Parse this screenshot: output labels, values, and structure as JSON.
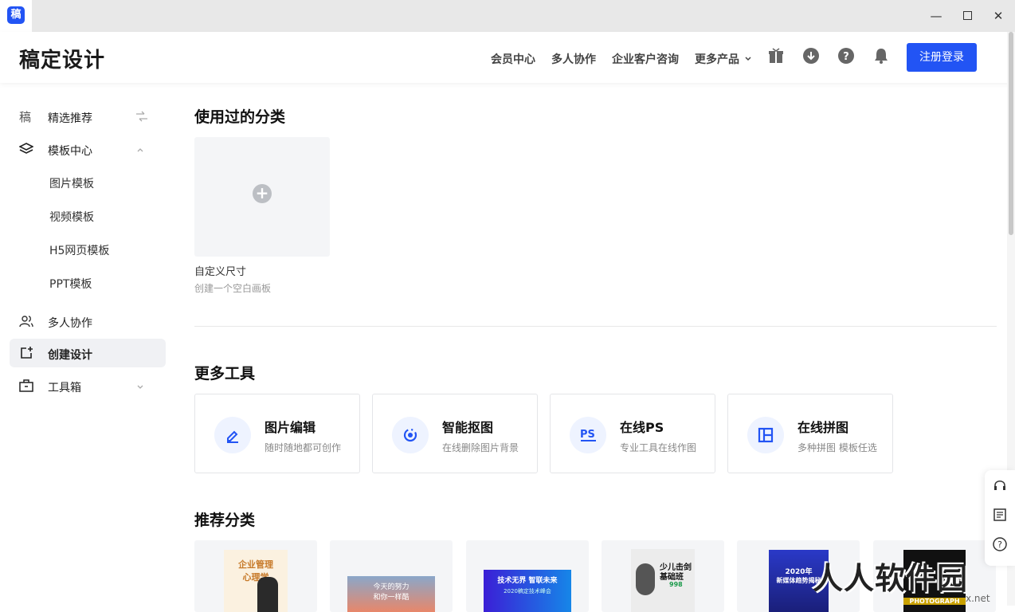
{
  "app": {
    "icon_char": "稿"
  },
  "window": {
    "minimize": "—",
    "maximize": "☐",
    "close": "✕"
  },
  "header": {
    "logo": "稿定设计",
    "nav": [
      "会员中心",
      "多人协作",
      "企业客户咨询",
      "更多产品"
    ],
    "more_caret": "⌄",
    "register_label": "注册登录",
    "accent": "#2254f4"
  },
  "sidebar": {
    "items": [
      {
        "label": "精选推荐",
        "icon": "gaoding-logo-icon"
      },
      {
        "label": "模板中心",
        "icon": "layers-icon"
      },
      {
        "label": "多人协作",
        "icon": "users-icon"
      },
      {
        "label": "创建设计",
        "icon": "create-icon"
      },
      {
        "label": "工具箱",
        "icon": "toolbox-icon"
      }
    ],
    "sub_items": [
      "图片模板",
      "视频模板",
      "H5网页模板",
      "PPT模板"
    ],
    "logo_char": "稿"
  },
  "main": {
    "used_title": "使用过的分类",
    "custom": {
      "plus": "+",
      "title": "自定义尺寸",
      "subtitle": "创建一个空白画板"
    },
    "tools_title": "更多工具",
    "tools": [
      {
        "title": "图片编辑",
        "subtitle": "随时随地都可创作",
        "icon": "edit-pen-icon"
      },
      {
        "title": "智能抠图",
        "subtitle": "在线删除图片背景",
        "icon": "cutout-icon"
      },
      {
        "title": "在线PS",
        "subtitle": "专业工具在线作图",
        "icon": "ps-icon"
      },
      {
        "title": "在线拼图",
        "subtitle": "多种拼图 模板任选",
        "icon": "collage-icon"
      }
    ],
    "recommend_title": "推荐分类",
    "thumbs": [
      {
        "lines": [
          "企业管理",
          "心理学"
        ]
      },
      {
        "lines": [
          "今天的努力",
          "和你一样酷"
        ]
      },
      {
        "lines": [
          "技术无界 智联未来",
          "2020稿定技术峰会"
        ]
      },
      {
        "lines": [
          "少儿击剑",
          "基础班",
          "998"
        ]
      },
      {
        "lines": [
          "2020年",
          "新媒体趋势揭秘"
        ]
      },
      {
        "lines": [
          "PHOTOGRAPH"
        ]
      }
    ]
  },
  "watermark": {
    "text": "人人软件园",
    "url": "x.net"
  }
}
